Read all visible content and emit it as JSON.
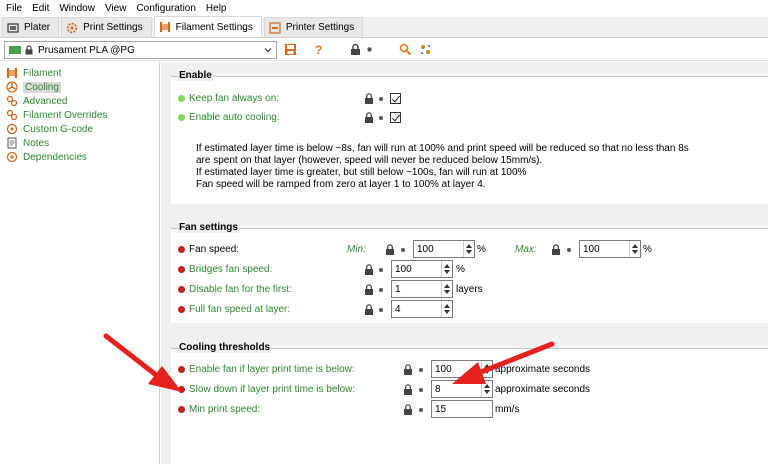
{
  "menu": [
    "File",
    "Edit",
    "Window",
    "View",
    "Configuration",
    "Help"
  ],
  "tabs": [
    {
      "label": "Plater",
      "icon": "plater-icon"
    },
    {
      "label": "Print Settings",
      "icon": "gear-icon"
    },
    {
      "label": "Filament Settings",
      "icon": "spool-icon"
    },
    {
      "label": "Printer Settings",
      "icon": "printer-icon"
    }
  ],
  "toolbar": {
    "preset": "Prusament PLA @PG",
    "icons": [
      "save-icon",
      "help-icon",
      "lock-icon",
      "bullet-icon",
      "search-icon",
      "compare-icon"
    ]
  },
  "sidebar": {
    "items": [
      {
        "label": "Filament",
        "icon": "filament-icon"
      },
      {
        "label": "Cooling",
        "icon": "cooling-icon"
      },
      {
        "label": "Advanced",
        "icon": "advanced-icon"
      },
      {
        "label": "Filament Overrides",
        "icon": "overrides-icon"
      },
      {
        "label": "Custom G-code",
        "icon": "gcode-icon"
      },
      {
        "label": "Notes",
        "icon": "notes-icon"
      },
      {
        "label": "Dependencies",
        "icon": "dependencies-icon"
      }
    ]
  },
  "enable": {
    "title": "Enable",
    "keep_fan": "Keep fan always on:",
    "auto_cooling": "Enable auto cooling:",
    "desc": [
      "If estimated layer time is below ~8s, fan will run at 100% and print speed will be reduced so that no less than 8s",
      "are spent on that layer (however, speed will never be reduced below 15mm/s).",
      "If estimated layer time is greater, but still below ~100s, fan will run at 100%",
      "Fan speed will be ramped from zero at layer 1 to 100% at layer 4."
    ]
  },
  "fan": {
    "title": "Fan settings",
    "fan_speed": "Fan speed:",
    "min_label": "Min:",
    "min_value": "100",
    "max_label": "Max:",
    "max_value": "100",
    "percent": "%",
    "bridges": "Bridges fan speed:",
    "bridges_value": "100",
    "disable_first": "Disable fan for the first:",
    "disable_value": "1",
    "layers": "layers",
    "full_speed": "Full fan speed at layer:",
    "full_value": "4"
  },
  "thresholds": {
    "title": "Cooling thresholds",
    "enable_fan": "Enable fan if layer print time is below:",
    "enable_fan_value": "100",
    "approx": "approximate seconds",
    "slow_down": "Slow down if layer print time is below:",
    "slow_down_value": "8",
    "min_speed": "Min print speed:",
    "min_speed_value": "15",
    "mms": "mm/s"
  },
  "colors": {
    "accent_green": "#2e8b2e",
    "arrow_red": "#e8201e"
  }
}
